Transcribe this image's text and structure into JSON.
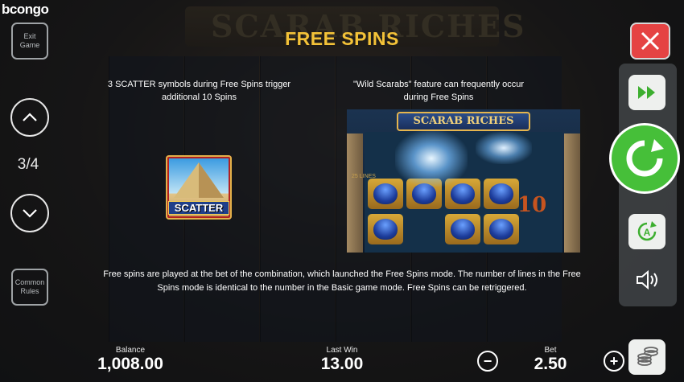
{
  "brand": "bcongo",
  "background": {
    "game_logo": "SCARAB RICHES"
  },
  "left_panel": {
    "exit_label_line1": "Exit",
    "exit_label_line2": "Game",
    "page_indicator": "3/4",
    "rules_label_line1": "Common",
    "rules_label_line2": "Rules"
  },
  "info": {
    "title": "FREE SPINS",
    "left_text": "3 SCATTER symbols during Free Spins trigger additional 10 Spins",
    "right_text": "\"Wild Scarabs\" feature can frequently occur during Free Spins",
    "scatter_label": "SCATTER",
    "screenshot_logo": "SCARAB RICHES",
    "screenshot_lines": "25 LINES",
    "screenshot_symbol": "10",
    "paragraph": "Free spins are played at the bet of the combination, which launched the Free Spins mode. The number of lines in the Free Spins mode is identical to the number in the Basic game mode. Free Spins can be retriggered."
  },
  "bottom": {
    "balance_label": "Balance",
    "balance_value": "1,008.00",
    "last_win_label": "Last Win",
    "last_win_value": "13.00",
    "bet_label": "Bet",
    "bet_value": "2.50",
    "minus": "−",
    "plus": "+"
  },
  "colors": {
    "title": "#f3c238",
    "close": "#e54343",
    "spin": "#46bf39"
  }
}
